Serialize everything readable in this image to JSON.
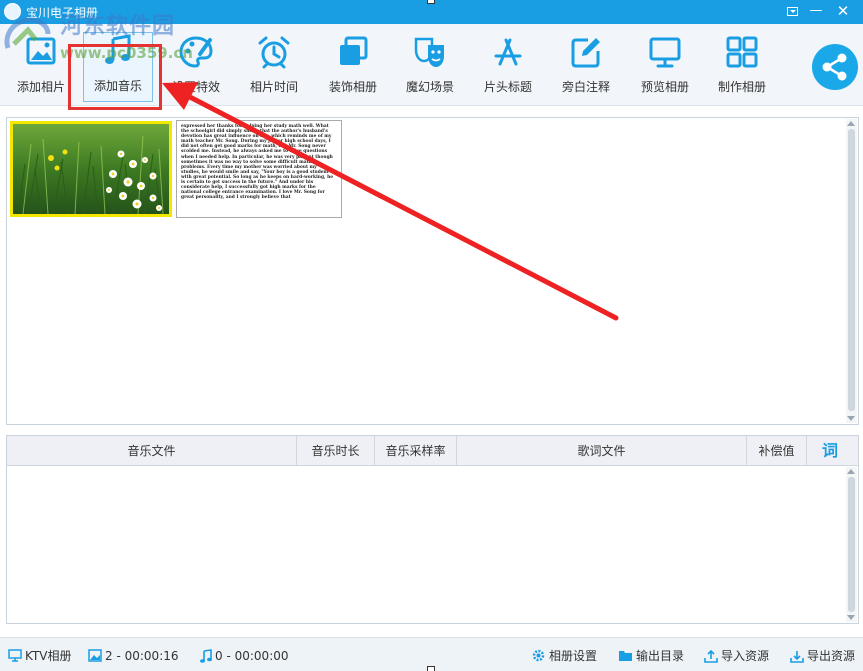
{
  "window": {
    "title": "宝川电子相册"
  },
  "watermark": {
    "site_name": "河东软件园",
    "url": "www.pc0359.cn"
  },
  "toolbar": {
    "items": [
      {
        "label": "添加相片",
        "icon": "add-photo-icon"
      },
      {
        "label": "添加音乐",
        "icon": "music-note-icon",
        "active": true
      },
      {
        "label": "设置特效",
        "icon": "palette-icon"
      },
      {
        "label": "相片时间",
        "icon": "alarm-clock-icon"
      },
      {
        "label": "装饰相册",
        "icon": "decorate-frames-icon"
      },
      {
        "label": "魔幻场景",
        "icon": "theater-masks-icon"
      },
      {
        "label": "片头标题",
        "icon": "app-store-a-icon"
      },
      {
        "label": "旁白注释",
        "icon": "edit-pen-icon"
      },
      {
        "label": "预览相册",
        "icon": "monitor-icon"
      },
      {
        "label": "制作相册",
        "icon": "grid-icon"
      }
    ],
    "share_icon": "share-icon"
  },
  "photos": {
    "document_text": "expressed her thanks for helping her study math well. What the schoolgirl did simply shows that the author's husband's devotion has great influence on her, which reminds me of my math teacher Mr. Song. During my junior high school days, I did not often get good marks for math, but Mr. Song never scolded me. Instead, he always asked me to raise questions when I needed help. In particular, he was very patient though sometimes it was no way to solve some difficult math problems. Every time my mother was worried about my studies, he would smile and say, \"Your boy is a good student with great potential. So long as he keeps on hard-working, he is certain to get success in the future.\" And under his considerate help, I successfully got high marks for the national college entrance examination. I love Mr. Song for great personality, and I strongly believe that"
  },
  "music_table": {
    "columns": [
      "音乐文件",
      "音乐时长",
      "音乐采样率",
      "歌词文件",
      "补偿值"
    ],
    "lyric_button": "词",
    "rows": []
  },
  "statusbar": {
    "ktv_label": "KTV相册",
    "photo_count": "2",
    "photo_duration": "00:00:16",
    "music_count": "0",
    "music_duration": "00:00:00",
    "settings_label": "相册设置",
    "output_label": "输出目录",
    "import_label": "导入资源",
    "export_label": "导出资源"
  },
  "colors": {
    "titlebar": "#1a9ee3",
    "accent": "#1a9ee3",
    "annotation_red": "#e53333"
  }
}
